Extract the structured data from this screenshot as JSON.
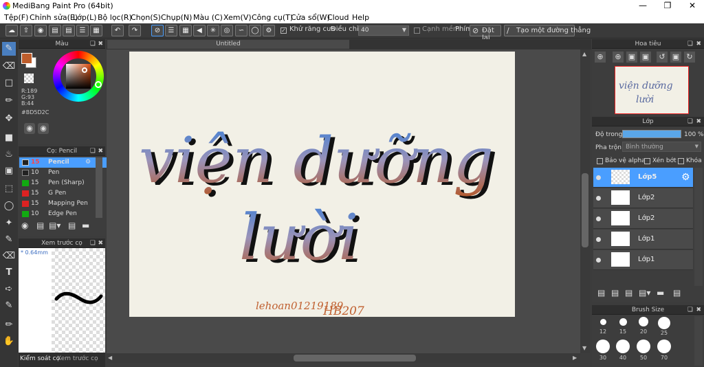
{
  "window": {
    "title": "MediBang Paint Pro (64bit)"
  },
  "menu": [
    "Tệp(F)",
    "Chỉnh sửa(E)",
    "Lớp(L)",
    "Bộ lọc(R)",
    "Chọn(S)",
    "Chụp(N)",
    "Màu (C)",
    "Xem(V)",
    "Công cụ(T)",
    "Cửa sổ(W)",
    "Cloud",
    "Help"
  ],
  "toolbar": {
    "antialias_label": "Khử răng cưa",
    "adjust_label": "Điều chỉnh",
    "adjust_value": "40",
    "edge_label": "Cạnh mềm",
    "keys_label": "Phím",
    "reset_label": "Đặt lại",
    "create_line_label": "Tạo một đường thẳng"
  },
  "color_panel": {
    "title": "Màu",
    "r": "R:189",
    "g": "G:93",
    "b": "B:44",
    "hex": "#BD5D2C",
    "fg_color": "#BD5D2C"
  },
  "brush_panel": {
    "title": "Cọ: Pencil",
    "items": [
      {
        "size": "15",
        "name": "Pencil",
        "color": "#222222",
        "selected": true
      },
      {
        "size": "10",
        "name": "Pen",
        "color": "#222222"
      },
      {
        "size": "15",
        "name": "Pen (Sharp)",
        "color": "#11aa11"
      },
      {
        "size": "15",
        "name": "G Pen",
        "color": "#dd2222"
      },
      {
        "size": "15",
        "name": "Mapping Pen",
        "color": "#dd2222"
      },
      {
        "size": "10",
        "name": "Edge Pen",
        "color": "#11aa11"
      }
    ]
  },
  "preview_panel": {
    "title": "Xem trước cọ",
    "size": "* 0.64mm"
  },
  "bottom_tabs": [
    "Kiểm soát cọ",
    "Xem trước cọ"
  ],
  "canvas": {
    "tab": "Untitled",
    "text_line1": "viện dưỡng",
    "text_line2": "lười",
    "signature": "lehoan01219189",
    "signature2": "HB207"
  },
  "navigator": {
    "title": "Hoa tiêu",
    "thumb_line1": "viện dưỡng",
    "thumb_line2": "lười"
  },
  "layer_panel": {
    "title": "Lớp",
    "opacity_label": "Độ trong",
    "opacity_value": "100 %",
    "blend_label": "Pha trộn",
    "blend_value": "Bình thường",
    "protect_alpha": "Bảo vệ alpha",
    "clipping": "Xén bớt",
    "lock": "Khóa",
    "layers": [
      {
        "name": "Lớp5",
        "selected": true
      },
      {
        "name": "Lớp2"
      },
      {
        "name": "Lớp2"
      },
      {
        "name": "Lớp1"
      },
      {
        "name": "Lớp1"
      }
    ]
  },
  "brush_size_panel": {
    "title": "Brush Size",
    "sizes": [
      "12",
      "15",
      "20",
      "25",
      "30",
      "40",
      "50",
      "70"
    ]
  }
}
